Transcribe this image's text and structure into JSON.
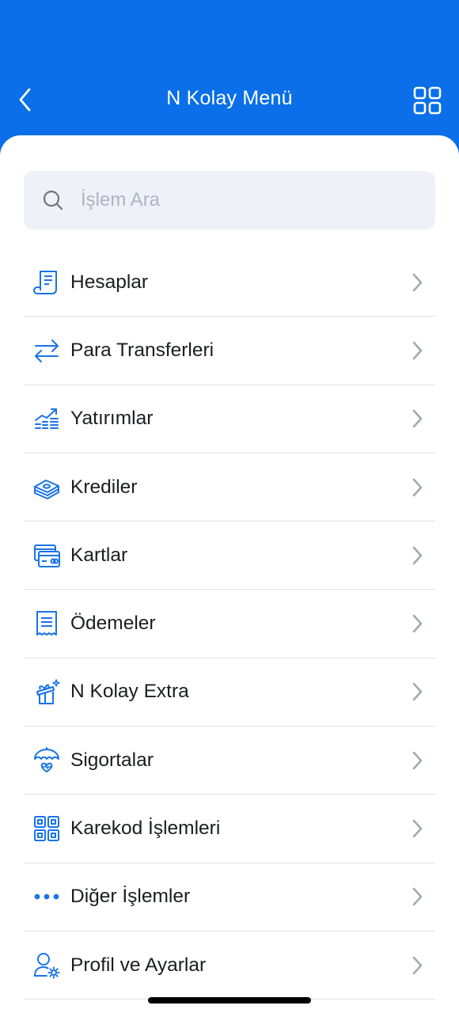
{
  "header": {
    "title": "N Kolay Menü",
    "back_icon": "chevron-left-icon",
    "grid_icon": "grid-icon"
  },
  "search": {
    "placeholder": "İşlem Ara",
    "icon": "search-icon"
  },
  "menu": {
    "items": [
      {
        "label": "Hesaplar",
        "icon": "document-icon"
      },
      {
        "label": "Para Transferleri",
        "icon": "transfer-arrows-icon"
      },
      {
        "label": "Yatırımlar",
        "icon": "investment-chart-icon"
      },
      {
        "label": "Krediler",
        "icon": "money-stack-icon"
      },
      {
        "label": "Kartlar",
        "icon": "credit-card-icon"
      },
      {
        "label": "Ödemeler",
        "icon": "receipt-icon"
      },
      {
        "label": "N Kolay Extra",
        "icon": "gift-icon"
      },
      {
        "label": "Sigortalar",
        "icon": "umbrella-heart-icon"
      },
      {
        "label": "Karekod İşlemleri",
        "icon": "qr-code-icon"
      },
      {
        "label": "Diğer İşlemler",
        "icon": "more-dots-icon"
      },
      {
        "label": "Profil ve Ayarlar",
        "icon": "user-settings-icon"
      }
    ]
  },
  "colors": {
    "brand_blue": "#0A6FE8",
    "icon_blue": "#1A73E8",
    "chevron_gray": "#A3A8B3",
    "search_bg": "#EEF1F8"
  }
}
